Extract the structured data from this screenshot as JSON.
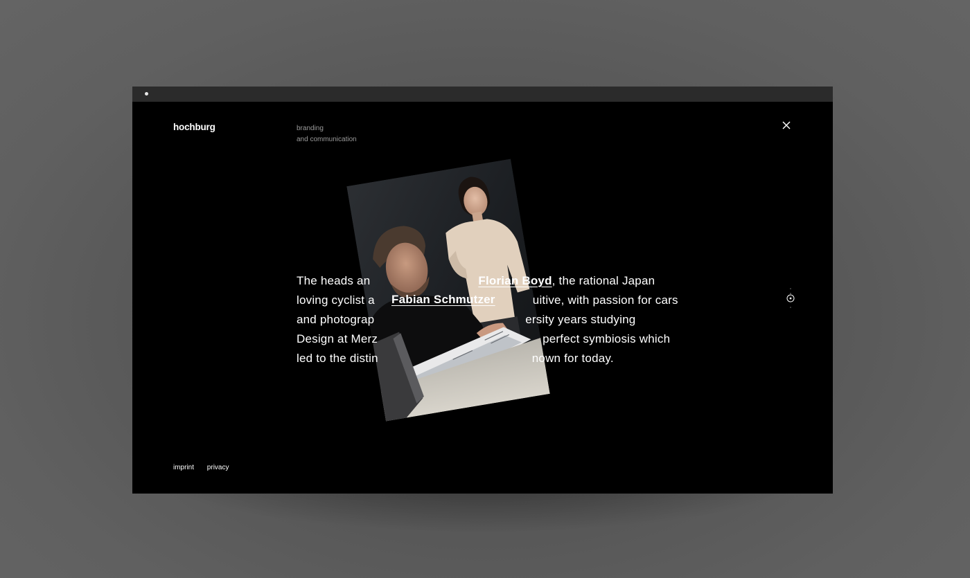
{
  "brand": {
    "logo": "hochburg",
    "tagline_line1": "branding",
    "tagline_line2": "and communication"
  },
  "intro": {
    "seg1": "The heads an",
    "name1": "Florian Boyd",
    "seg2": ", the rational Japan",
    "seg3": "loving cyclist a",
    "seg4": "uitive, with passion for cars",
    "seg5": "and photograp",
    "seg6": "ersity years studying",
    "seg7": "Design at Merz",
    "seg8": "perfect symbiosis which",
    "seg9": "led to the distin",
    "seg10": "nown for today.",
    "name2": "Fabian Schmutzer"
  },
  "footer": {
    "imprint": "imprint",
    "privacy": "privacy"
  },
  "icons": {
    "close": "close-icon",
    "scroll": "scroll-indicator-icon"
  },
  "colors": {
    "background": "#000000",
    "titlebar": "#2b2b2b",
    "text": "#ffffff",
    "muted": "#9a9a9a"
  }
}
